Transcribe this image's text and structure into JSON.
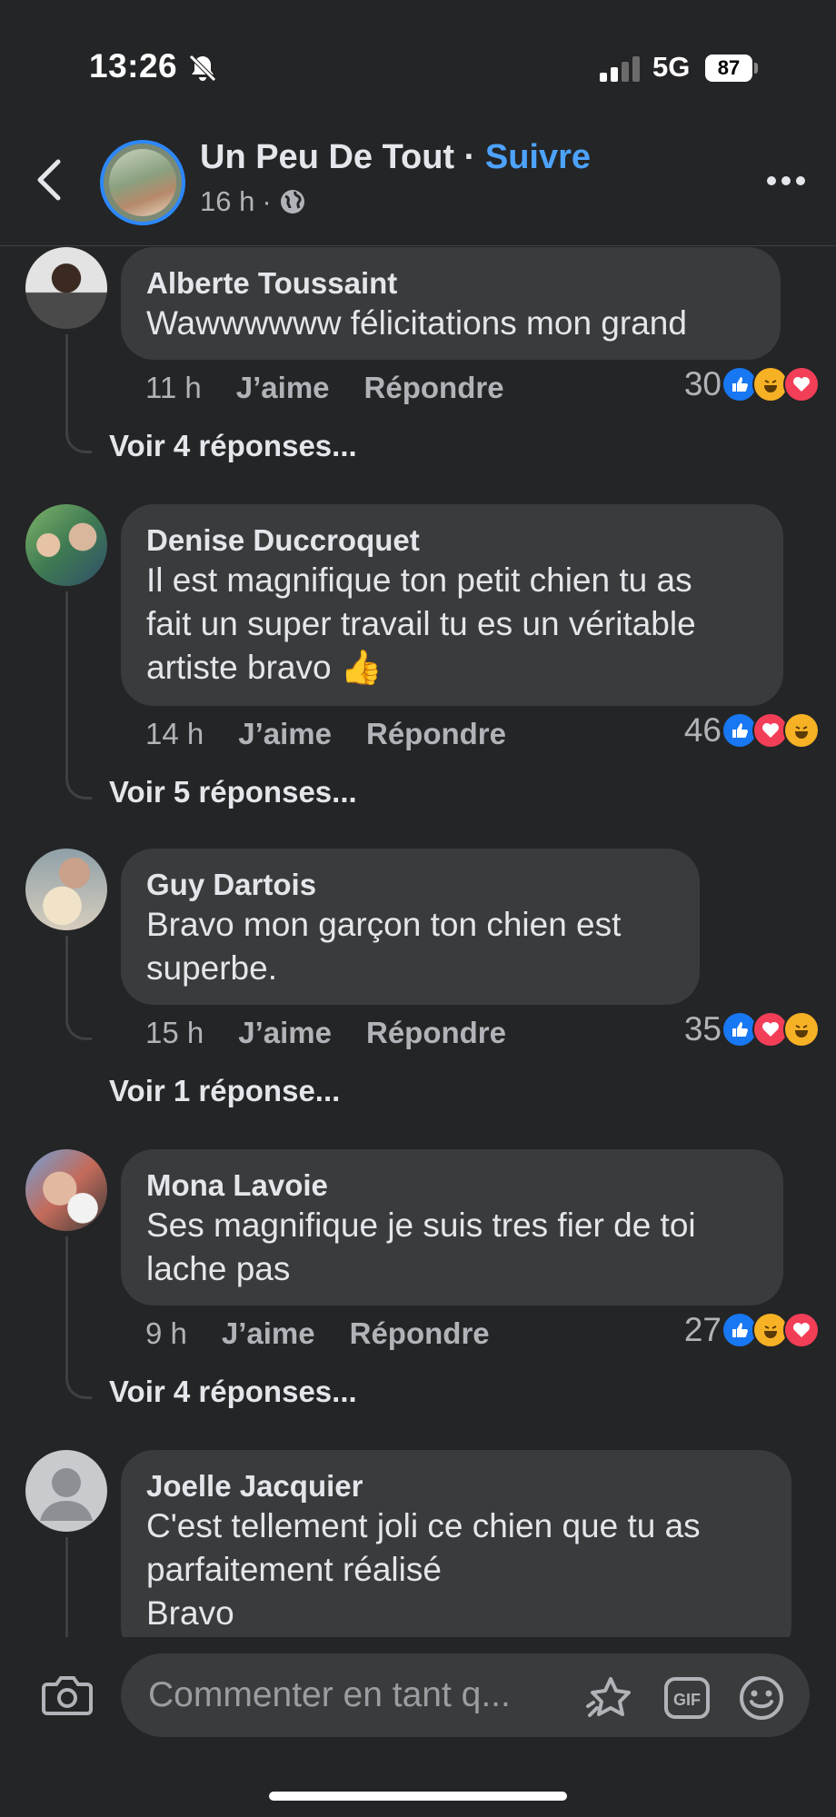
{
  "status_bar": {
    "time": "13:26",
    "network": "5G",
    "battery": "87"
  },
  "header": {
    "page_name": "Un Peu De Tout",
    "separator": " · ",
    "follow_label": "Suivre",
    "age": "16 h",
    "dot": "·"
  },
  "comments": [
    {
      "author": "Alberte Toussaint",
      "text": "Wawwwwww félicitations mon grand",
      "time": "11 h",
      "like": "J’aime",
      "reply": "Répondre",
      "reaction_count": "30",
      "reactions": [
        "like",
        "haha",
        "love"
      ],
      "replies_label": "Voir 4 réponses..."
    },
    {
      "author": "Denise Duccroquet",
      "text": "Il est magnifique ton petit chien tu as\nfait un super travail tu es un véritable\nartiste bravo 👍",
      "time": "14 h",
      "like": "J’aime",
      "reply": "Répondre",
      "reaction_count": "46",
      "reactions": [
        "like",
        "love",
        "haha"
      ],
      "replies_label": "Voir 5 réponses..."
    },
    {
      "author": "Guy Dartois",
      "text": "Bravo mon garçon ton chien est\nsuperbe.",
      "time": "15 h",
      "like": "J’aime",
      "reply": "Répondre",
      "reaction_count": "35",
      "reactions": [
        "like",
        "love",
        "haha"
      ],
      "replies_label": "Voir 1 réponse..."
    },
    {
      "author": "Mona Lavoie",
      "text": "Ses magnifique je suis tres fier de toi\nlache pas",
      "time": "9 h",
      "like": "J’aime",
      "reply": "Répondre",
      "reaction_count": "27",
      "reactions": [
        "like",
        "haha",
        "love"
      ],
      "replies_label": "Voir 4 réponses..."
    },
    {
      "author": "Joelle Jacquier",
      "text": "C'est tellement joli ce chien que tu as\nparfaitement réalisé\n Bravo"
    }
  ],
  "composer": {
    "placeholder": "Commenter en tant q..."
  },
  "icons": {
    "back": "chevron-left-icon",
    "more": "more-horizontal-icon",
    "globe": "globe-icon",
    "camera": "camera-icon",
    "sticker": "sticker-icon",
    "gif": "gif-icon",
    "emoji": "emoji-icon"
  },
  "colors": {
    "background": "#242526",
    "bubble": "#3a3b3c",
    "accent": "#4da3ff",
    "like": "#1877f2",
    "love": "#f33e58",
    "haha": "#f7b125"
  }
}
